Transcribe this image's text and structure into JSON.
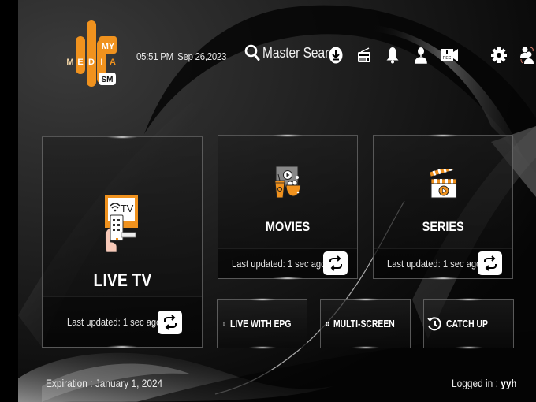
{
  "app": {
    "logo": {
      "top_word": "MY",
      "main_word": [
        "M",
        "E",
        "D",
        "I",
        "A"
      ],
      "badge": "SM",
      "accent": "#F0921E"
    }
  },
  "header": {
    "time": "05:51 PM",
    "date": "Sep 26,2023",
    "search": {
      "icon": "search-icon",
      "label": "Master Search"
    },
    "toolbar": [
      {
        "icon": "download-icon",
        "label": "Downloads"
      },
      {
        "icon": "radio-icon",
        "label": "Radio"
      },
      {
        "icon": "bell-icon",
        "label": "Notifications"
      },
      {
        "icon": "user-icon",
        "label": "Account"
      },
      {
        "icon": "recordings-icon",
        "label": "Recordings"
      },
      {
        "icon": "gear-icon",
        "label": "Settings"
      },
      {
        "icon": "switch-user-icon",
        "label": "Switch User"
      }
    ]
  },
  "tiles": {
    "live_tv": {
      "title": "LIVE TV",
      "updated": "Last updated: 1 sec ago",
      "icon": "live-tv-icon"
    },
    "movies": {
      "title": "MOVIES",
      "updated": "Last updated: 1 sec ago",
      "icon": "movies-icon"
    },
    "series": {
      "title": "SERIES",
      "updated": "Last updated: 1 sec ago",
      "icon": "series-icon"
    }
  },
  "shortcuts": [
    {
      "label": "LIVE WITH EPG",
      "icon": "epg-book-icon"
    },
    {
      "label": "MULTI-SCREEN",
      "icon": "grid-icon"
    },
    {
      "label": "CATCH UP",
      "icon": "history-icon"
    }
  ],
  "footer": {
    "expiration": "Expiration : January 1, 2024",
    "logged_in_label": "Logged in : ",
    "username": "yyh"
  },
  "colors": {
    "accent": "#F0921E",
    "background": "#0A0A0A",
    "text": "#FFFFFF"
  }
}
